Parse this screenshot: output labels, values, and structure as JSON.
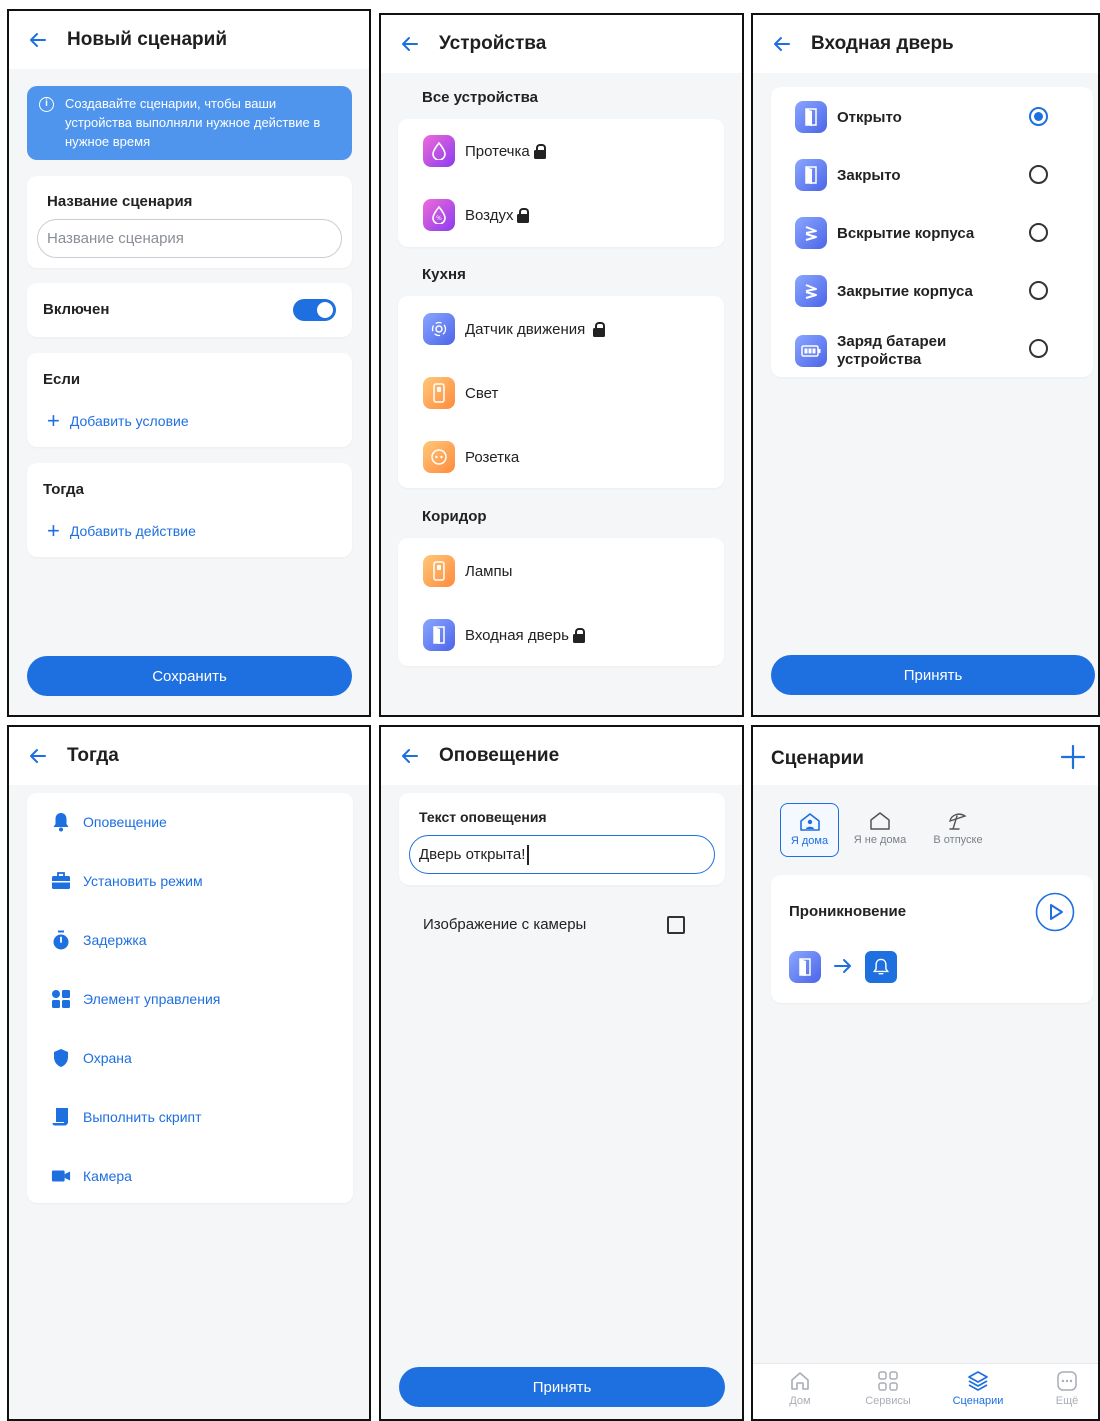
{
  "screen1": {
    "title": "Новый сценарий",
    "info": "Создавайте сценарии, чтобы ваши устройства выполняли нужное действие в нужное время",
    "name_label": "Название сценария",
    "name_placeholder": "Название сценария",
    "enabled_label": "Включен",
    "enabled": true,
    "if_label": "Если",
    "add_condition": "Добавить условие",
    "then_label": "Тогда",
    "add_action": "Добавить действие",
    "save": "Сохранить"
  },
  "screen2": {
    "title": "Устройства",
    "sections": [
      {
        "title": "Все устройства",
        "items": [
          {
            "label": "Протечка",
            "icon": "water-drop-icon",
            "locked": true
          },
          {
            "label": "Воздух",
            "icon": "humidity-icon",
            "locked": true
          }
        ]
      },
      {
        "title": "Кухня",
        "items": [
          {
            "label": "Датчик движения",
            "icon": "motion-sensor-icon",
            "locked": true
          },
          {
            "label": "Свет",
            "icon": "light-switch-icon",
            "locked": false
          },
          {
            "label": "Розетка",
            "icon": "socket-icon",
            "locked": false
          }
        ]
      },
      {
        "title": "Коридор",
        "items": [
          {
            "label": "Лампы",
            "icon": "light-switch-icon",
            "locked": false
          },
          {
            "label": "Входная дверь",
            "icon": "door-icon",
            "locked": true
          }
        ]
      }
    ]
  },
  "screen3": {
    "title": "Входная дверь",
    "options": [
      {
        "label": "Открыто",
        "icon": "door-icon",
        "selected": true
      },
      {
        "label": "Закрыто",
        "icon": "door-icon",
        "selected": false
      },
      {
        "label": "Вскрытие корпуса",
        "icon": "tamper-icon",
        "selected": false
      },
      {
        "label": "Закрытие корпуса",
        "icon": "tamper-icon",
        "selected": false
      },
      {
        "label": "Заряд батареи устройства",
        "icon": "battery-icon",
        "selected": false
      }
    ],
    "accept": "Принять"
  },
  "screen4": {
    "title": "Тогда",
    "actions": [
      {
        "label": "Оповещение",
        "icon": "bell-icon"
      },
      {
        "label": "Установить режим",
        "icon": "briefcase-icon"
      },
      {
        "label": "Задержка",
        "icon": "timer-icon"
      },
      {
        "label": "Элемент управления",
        "icon": "grid-icon"
      },
      {
        "label": "Охрана",
        "icon": "shield-icon"
      },
      {
        "label": "Выполнить скрипт",
        "icon": "script-icon"
      },
      {
        "label": "Камера",
        "icon": "camera-icon"
      }
    ]
  },
  "screen5": {
    "title": "Оповещение",
    "text_label": "Текст оповещения",
    "text_value": "Дверь открыта!",
    "camera_label": "Изображение с камеры",
    "camera_checked": false,
    "accept": "Принять"
  },
  "screen6": {
    "title": "Сценарии",
    "modes": [
      {
        "label": "Я дома",
        "icon": "home-person-icon",
        "active": true
      },
      {
        "label": "Я не дома",
        "icon": "home-icon",
        "active": false
      },
      {
        "label": "В отпуске",
        "icon": "umbrella-icon",
        "active": false
      }
    ],
    "scenario": {
      "name": "Проникновение"
    },
    "nav": [
      {
        "label": "Дом",
        "icon": "house-icon",
        "active": false
      },
      {
        "label": "Сервисы",
        "icon": "services-icon",
        "active": false
      },
      {
        "label": "Сценарии",
        "icon": "layers-icon",
        "active": true
      },
      {
        "label": "Ещё",
        "icon": "more-icon",
        "active": false
      }
    ]
  },
  "colors": {
    "accent": "#1e6fe0",
    "info": "#4f95ee",
    "background": "#f5f6f8"
  }
}
